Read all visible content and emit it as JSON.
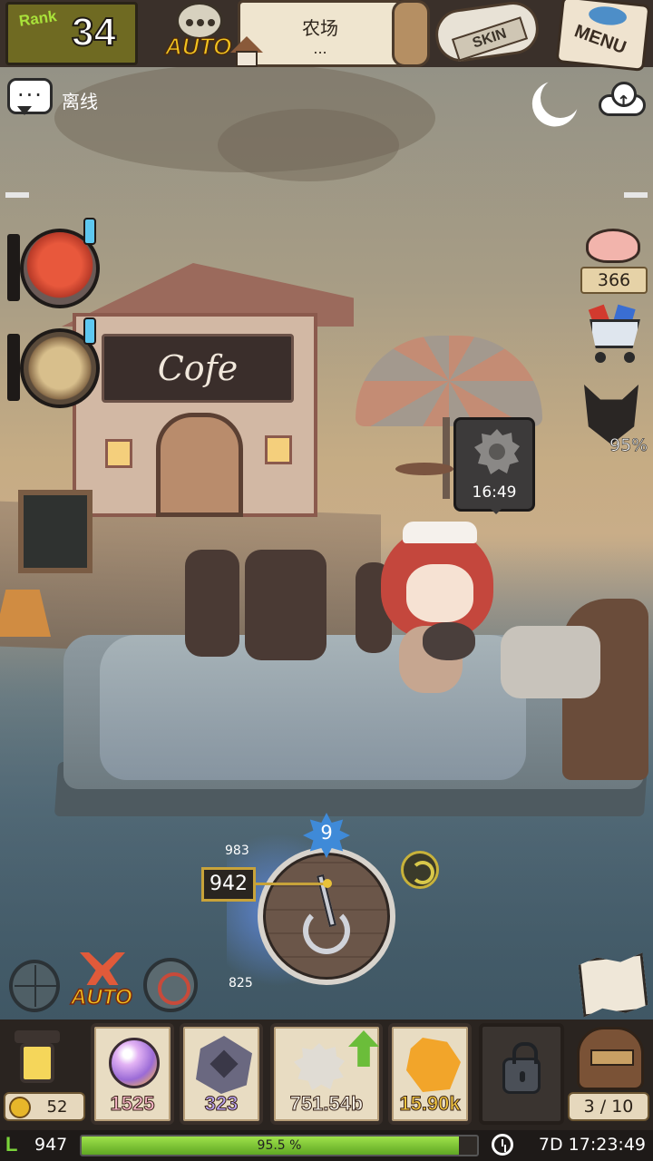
{
  "hud": {
    "rank_label": "Rank",
    "rank_value": "34",
    "auto_label": "AUTO",
    "location_name": "农场",
    "location_sub": "...",
    "skin_label": "SKIN",
    "menu_label": "MENU"
  },
  "status": {
    "connection": "离线"
  },
  "right_panel": {
    "meat_count": "366",
    "mask_percent": "95%"
  },
  "scene": {
    "cafe_sign": "Cofe",
    "timer": "16:49"
  },
  "fishing": {
    "level": "9",
    "depth_current": "942",
    "depth_max": "983",
    "depth_min": "825",
    "auto_battle_label": "AUTO"
  },
  "inventory": {
    "gold": "52",
    "slots": [
      {
        "item": "orb",
        "value": "1525",
        "color": "#f7b6c8"
      },
      {
        "item": "shard",
        "value": "323",
        "color": "#b9a4f2"
      },
      {
        "item": "shell",
        "value": "751.54b",
        "color": "#f4f0e6"
      },
      {
        "item": "crystal",
        "value": "15.90k",
        "color": "#f2c640"
      }
    ],
    "bag_count": "3 / 10"
  },
  "footer": {
    "level": "947",
    "xp_percent": 95.5,
    "xp_text": "95.5 %",
    "time": "7D 17:23:49"
  }
}
